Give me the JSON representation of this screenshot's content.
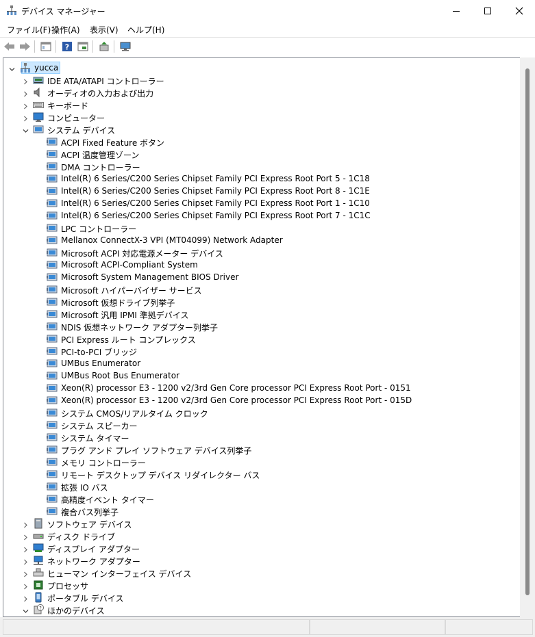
{
  "window": {
    "title": "デバイス マネージャー"
  },
  "menu": [
    "ファイル(F)",
    "操作(A)",
    "表示(V)",
    "ヘルプ(H)"
  ],
  "tree": [
    {
      "label": "yucca",
      "level": 0,
      "expander": "expanded",
      "icon": "computer-root",
      "selected": true
    },
    {
      "label": "IDE ATA/ATAPI コントローラー",
      "level": 1,
      "expander": "collapsed",
      "icon": "ide"
    },
    {
      "label": "オーディオの入力および出力",
      "level": 1,
      "expander": "collapsed",
      "icon": "audio"
    },
    {
      "label": "キーボード",
      "level": 1,
      "expander": "collapsed",
      "icon": "keyboard"
    },
    {
      "label": "コンピューター",
      "level": 1,
      "expander": "collapsed",
      "icon": "monitor"
    },
    {
      "label": "システム デバイス",
      "level": 1,
      "expander": "expanded",
      "icon": "system-folder"
    },
    {
      "label": "ACPI Fixed Feature ボタン",
      "level": 2,
      "icon": "system-device"
    },
    {
      "label": "ACPI 温度管理ゾーン",
      "level": 2,
      "icon": "system-device"
    },
    {
      "label": "DMA コントローラー",
      "level": 2,
      "icon": "system-device"
    },
    {
      "label": "Intel(R) 6 Series/C200 Series Chipset Family PCI Express Root Port 5 - 1C18",
      "level": 2,
      "icon": "system-device"
    },
    {
      "label": "Intel(R) 6 Series/C200 Series Chipset Family PCI Express Root Port 8 - 1C1E",
      "level": 2,
      "icon": "system-device"
    },
    {
      "label": "Intel(R) 6 Series/C200 Series Chipset Family PCI Express Root Port 1 - 1C10",
      "level": 2,
      "icon": "system-device"
    },
    {
      "label": "Intel(R) 6 Series/C200 Series Chipset Family PCI Express Root Port 7 - 1C1C",
      "level": 2,
      "icon": "system-device"
    },
    {
      "label": "LPC コントローラー",
      "level": 2,
      "icon": "system-device"
    },
    {
      "label": "Mellanox ConnectX-3 VPI (MT04099) Network Adapter",
      "level": 2,
      "icon": "system-device"
    },
    {
      "label": "Microsoft ACPI 対応電源メーター デバイス",
      "level": 2,
      "icon": "system-device"
    },
    {
      "label": "Microsoft ACPI-Compliant System",
      "level": 2,
      "icon": "system-device"
    },
    {
      "label": "Microsoft System Management BIOS Driver",
      "level": 2,
      "icon": "system-device"
    },
    {
      "label": "Microsoft ハイパーバイザー サービス",
      "level": 2,
      "icon": "system-device"
    },
    {
      "label": "Microsoft 仮想ドライブ列挙子",
      "level": 2,
      "icon": "system-device"
    },
    {
      "label": "Microsoft 汎用 IPMI 準拠デバイス",
      "level": 2,
      "icon": "system-device"
    },
    {
      "label": "NDIS 仮想ネットワーク アダプター列挙子",
      "level": 2,
      "icon": "system-device"
    },
    {
      "label": "PCI Express ルート コンプレックス",
      "level": 2,
      "icon": "system-device"
    },
    {
      "label": "PCI-to-PCI ブリッジ",
      "level": 2,
      "icon": "system-device"
    },
    {
      "label": "UMBus Enumerator",
      "level": 2,
      "icon": "system-device"
    },
    {
      "label": "UMBus Root Bus Enumerator",
      "level": 2,
      "icon": "system-device"
    },
    {
      "label": "Xeon(R) processor E3 - 1200 v2/3rd Gen Core processor PCI Express Root Port - 0151",
      "level": 2,
      "icon": "system-device"
    },
    {
      "label": "Xeon(R) processor E3 - 1200 v2/3rd Gen Core processor PCI Express Root Port - 015D",
      "level": 2,
      "icon": "system-device"
    },
    {
      "label": "システム CMOS/リアルタイム クロック",
      "level": 2,
      "icon": "system-device"
    },
    {
      "label": "システム スピーカー",
      "level": 2,
      "icon": "system-device"
    },
    {
      "label": "システム タイマー",
      "level": 2,
      "icon": "system-device"
    },
    {
      "label": "プラグ アンド プレイ ソフトウェア デバイス列挙子",
      "level": 2,
      "icon": "system-device"
    },
    {
      "label": "メモリ コントローラー",
      "level": 2,
      "icon": "system-device"
    },
    {
      "label": "リモート デスクトップ デバイス リダイレクター バス",
      "level": 2,
      "icon": "system-device"
    },
    {
      "label": "拡張 IO バス",
      "level": 2,
      "icon": "system-device"
    },
    {
      "label": "高精度イベント タイマー",
      "level": 2,
      "icon": "system-device"
    },
    {
      "label": "複合バス列挙子",
      "level": 2,
      "icon": "system-device"
    },
    {
      "label": "ソフトウェア デバイス",
      "level": 1,
      "expander": "collapsed",
      "icon": "software"
    },
    {
      "label": "ディスク ドライブ",
      "level": 1,
      "expander": "collapsed",
      "icon": "disk"
    },
    {
      "label": "ディスプレイ アダプター",
      "level": 1,
      "expander": "collapsed",
      "icon": "display"
    },
    {
      "label": "ネットワーク アダプター",
      "level": 1,
      "expander": "collapsed",
      "icon": "network"
    },
    {
      "label": "ヒューマン インターフェイス デバイス",
      "level": 1,
      "expander": "collapsed",
      "icon": "hid"
    },
    {
      "label": "プロセッサ",
      "level": 1,
      "expander": "collapsed",
      "icon": "processor"
    },
    {
      "label": "ポータブル デバイス",
      "level": 1,
      "expander": "collapsed",
      "icon": "portable"
    },
    {
      "label": "ほかのデバイス",
      "level": 1,
      "expander": "expanded",
      "icon": "other"
    }
  ]
}
